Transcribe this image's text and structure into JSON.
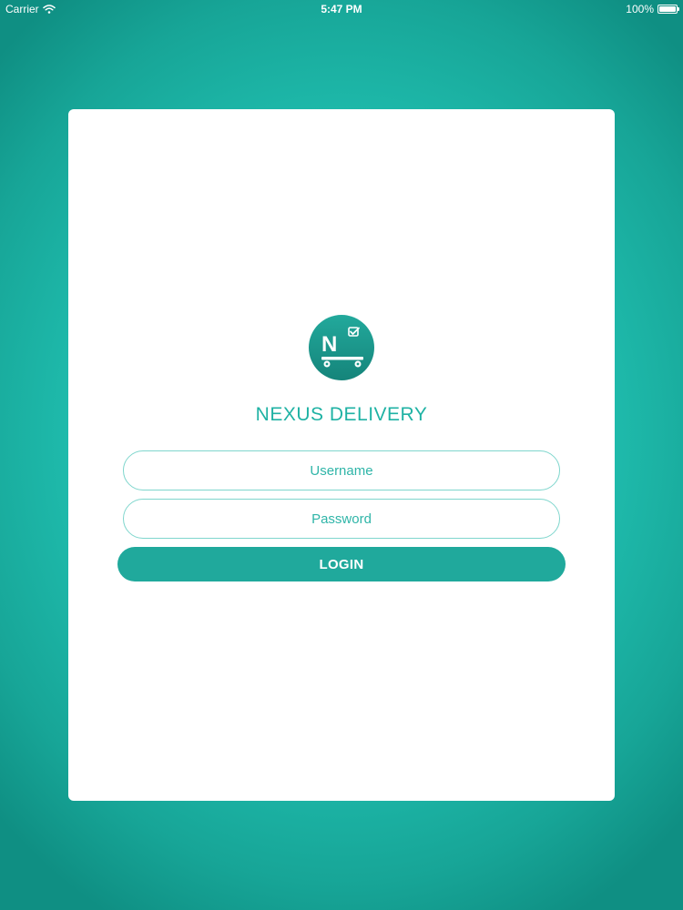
{
  "status_bar": {
    "carrier": "Carrier",
    "time": "5:47 PM",
    "battery": "100%",
    "battery_level": 1.0,
    "icons": [
      "wifi-icon",
      "battery-icon"
    ]
  },
  "login": {
    "logo_letter": "N",
    "logo_icon": "checkbox-icon",
    "title": "NEXUS DELIVERY",
    "username_placeholder": "Username",
    "username_value": "",
    "password_placeholder": "Password",
    "password_value": "",
    "button_label": "LOGIN"
  },
  "colors": {
    "background": "#1fbcad",
    "card": "#ffffff",
    "accent": "#20a99c",
    "field_border": "#7fd6cd",
    "title": "#1fb2a4"
  }
}
